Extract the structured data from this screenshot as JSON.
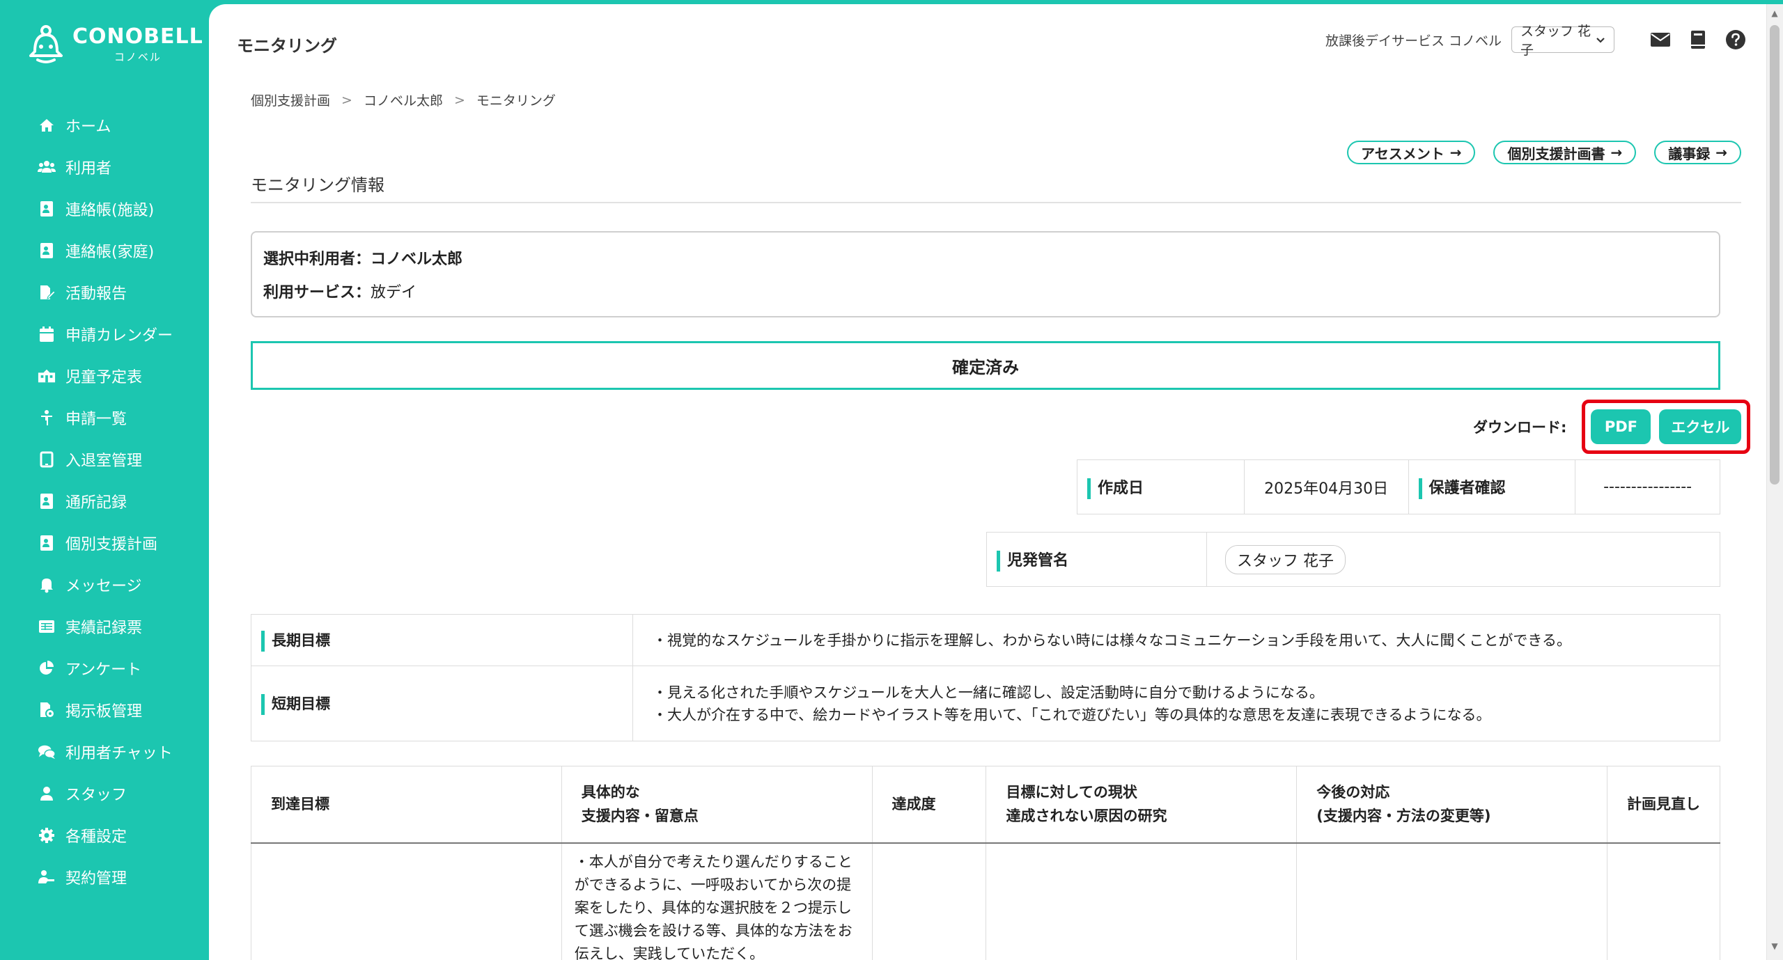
{
  "brand": {
    "name": "CONOBELL",
    "sub": "コノベル"
  },
  "sidebar": {
    "items": [
      {
        "label": "ホーム",
        "icon": "home-icon"
      },
      {
        "label": "利用者",
        "icon": "users-icon"
      },
      {
        "label": "連絡帳(施設)",
        "icon": "contact-book-icon"
      },
      {
        "label": "連絡帳(家庭)",
        "icon": "contact-book-icon"
      },
      {
        "label": "活動報告",
        "icon": "report-edit-icon"
      },
      {
        "label": "申請カレンダー",
        "icon": "calendar-icon"
      },
      {
        "label": "児童予定表",
        "icon": "schedule-icon"
      },
      {
        "label": "申請一覧",
        "icon": "child-icon"
      },
      {
        "label": "入退室管理",
        "icon": "tablet-icon"
      },
      {
        "label": "通所記録",
        "icon": "contact-book-icon"
      },
      {
        "label": "個別支援計画",
        "icon": "contact-book-icon"
      },
      {
        "label": "メッセージ",
        "icon": "bell-icon"
      },
      {
        "label": "実績記録票",
        "icon": "table-icon"
      },
      {
        "label": "アンケート",
        "icon": "pie-chart-icon"
      },
      {
        "label": "掲示板管理",
        "icon": "file-settings-icon"
      },
      {
        "label": "利用者チャット",
        "icon": "chat-icon"
      },
      {
        "label": "スタッフ",
        "icon": "user-icon"
      },
      {
        "label": "各種設定",
        "icon": "gear-icon"
      },
      {
        "label": "契約管理",
        "icon": "handshake-icon"
      }
    ]
  },
  "header": {
    "title": "モニタリング",
    "facility": "放課後デイサービス コノベル",
    "staff_selected": "スタッフ 花子"
  },
  "breadcrumb": [
    "個別支援計画",
    "コノベル太郎",
    "モニタリング"
  ],
  "links": [
    "アセスメント",
    "個別支援計画書",
    "議事録"
  ],
  "section_title": "モニタリング情報",
  "info": {
    "user_label": "選択中利用者：",
    "user_value": "コノベル太郎",
    "service_label": "利用サービス：",
    "service_value": "放デイ"
  },
  "status": "確定済み",
  "download": {
    "label": "ダウンロード:",
    "pdf": "PDF",
    "excel": "エクセル"
  },
  "meta": {
    "created_label": "作成日",
    "created_value": "2025年04月30日",
    "guardian_label": "保護者確認",
    "guardian_value": "----------------",
    "manager_label": "児発管名",
    "manager_value": "スタッフ 花子"
  },
  "goals": {
    "long_label": "長期目標",
    "long_text": "・視覚的なスケジュールを手掛かりに指示を理解し、わからない時には様々なコミュニケーション手段を用いて、大人に聞くことができる。",
    "short_label": "短期目標",
    "short_text_1": "・見える化された手順やスケジュールを大人と一緒に確認し、設定活動時に自分で動けるようになる。",
    "short_text_2": "・大人が介在する中で、絵カードやイラスト等を用いて、「これで遊びたい」等の具体的な意思を友達に表現できるようになる。"
  },
  "plan": {
    "headers": [
      [
        "到達目標"
      ],
      [
        "具体的な",
        "支援内容・留意点"
      ],
      [
        "達成度"
      ],
      [
        "目標に対しての現状",
        "達成されない原因の研究"
      ],
      [
        "今後の対応",
        "(支援内容・方法の変更等)"
      ],
      [
        "計画見直し"
      ]
    ],
    "row1_support": "・本人が自分で考えたり選んだりすることができるように、一呼吸おいてから次の提案をしたり、具体的な選択肢を２つ提示して選ぶ機会を設ける等、具体的な方法をお伝えし、実践していただく。"
  },
  "colors": {
    "accent": "#1cc6b0",
    "highlight": "#e60012"
  }
}
